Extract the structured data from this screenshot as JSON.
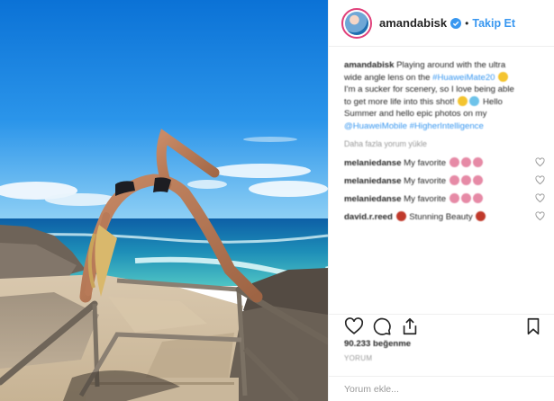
{
  "header": {
    "username": "amandabisk",
    "separator": "•",
    "follow_label": "Takip Et",
    "verified_icon": "verified-badge-icon",
    "colors": {
      "follow": "#3897f0",
      "verified": "#3897f0",
      "avatar_ring": "#e0407a"
    }
  },
  "caption": {
    "username": "amandabisk",
    "line1": "Playing around with the ultra",
    "line2a": "wide angle lens on the",
    "hashtag1": "#HuaweiMate20",
    "line3": "I'm a sucker for scenery, so I love being able",
    "line4a": "to get more life into this shot!",
    "line4b": "Hello",
    "line5": "Summer and hello epic photos on my",
    "hashtag2": "@HuaweiMobile",
    "hashtag3": "#HigherIntelligence"
  },
  "translate_label": "Daha fazla yorum yükle",
  "comments": [
    {
      "user": "melaniedanse",
      "text": "My favorite"
    },
    {
      "user": "melaniedanse",
      "text": "My favorite"
    },
    {
      "user": "melaniedanse",
      "text": "My favorite"
    },
    {
      "user": "david.r.reed",
      "text": "Stunning Beauty"
    }
  ],
  "actions": {
    "like_icon": "heart-icon",
    "comment_icon": "comment-icon",
    "share_icon": "share-icon",
    "save_icon": "bookmark-icon"
  },
  "likes_text": "90.233 beğenme",
  "time_text": "YORUM",
  "comment_placeholder": "Yorum ekle..."
}
